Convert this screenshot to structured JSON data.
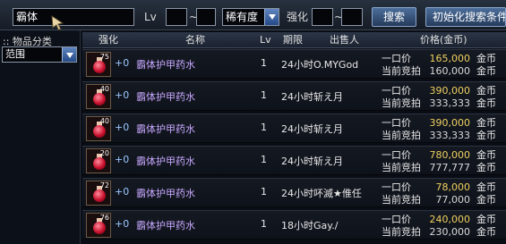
{
  "search": {
    "keyword": "霸体",
    "lv_label": "Lv",
    "lv_min": "",
    "lv_sep": "~",
    "lv_max": "",
    "rarity_label": "稀有度",
    "enhance_label": "强化",
    "enhance_min": "",
    "enhance_sep": "~",
    "enhance_max": "",
    "search_button": "搜索",
    "reset_button": "初始化搜索条件"
  },
  "sidebar": {
    "category_label": ":: 物品分类",
    "range_label": "范围"
  },
  "table": {
    "headers": {
      "enhance": "强化",
      "name": "名称",
      "lv": "Lv",
      "period": "期限",
      "seller": "出售人",
      "price": "价格(金币)"
    },
    "rows": [
      {
        "icon_level": "75",
        "enhance": "+0",
        "name": "霸体护甲药水",
        "lv": "1",
        "period": "24小时",
        "seller": "O.MYGod",
        "buyout_label": "一口价",
        "buyout": "165,000",
        "bid_label": "当前竞拍",
        "bid": "160,000",
        "unit": "金币"
      },
      {
        "icon_level": "40",
        "enhance": "+0",
        "name": "霸体护甲药水",
        "lv": "1",
        "period": "24小时",
        "seller": "斩え月",
        "buyout_label": "一口价",
        "buyout": "390,000",
        "bid_label": "当前竞拍",
        "bid": "333,333",
        "unit": "金币"
      },
      {
        "icon_level": "40",
        "enhance": "+0",
        "name": "霸体护甲药水",
        "lv": "1",
        "period": "24小时",
        "seller": "斩え月",
        "buyout_label": "一口价",
        "buyout": "390,000",
        "bid_label": "当前竞拍",
        "bid": "333,333",
        "unit": "金币"
      },
      {
        "icon_level": "20",
        "enhance": "+0",
        "name": "霸体护甲药水",
        "lv": "1",
        "period": "24小时",
        "seller": "斩え月",
        "buyout_label": "一口价",
        "buyout": "780,000",
        "bid_label": "当前竞拍",
        "bid": "777,777",
        "unit": "金币"
      },
      {
        "icon_level": "72",
        "enhance": "+0",
        "name": "霸体护甲药水",
        "lv": "1",
        "period": "24小时",
        "seller": "吥滅★倠任",
        "buyout_label": "一口价",
        "buyout": "78,000",
        "bid_label": "当前竞拍",
        "bid": "77,000",
        "unit": "金币"
      },
      {
        "icon_level": "76",
        "enhance": "+0",
        "name": "霸体护甲药水",
        "lv": "1",
        "period": "18小时",
        "seller": "Gay./",
        "buyout_label": "一口价",
        "buyout": "240,000",
        "bid_label": "当前竞拍",
        "bid": "230,000",
        "unit": "金币"
      }
    ]
  },
  "colors": {
    "name": "#c8a8ff",
    "enhance": "#9ac8ff",
    "buyout_price": "#f0d060"
  }
}
